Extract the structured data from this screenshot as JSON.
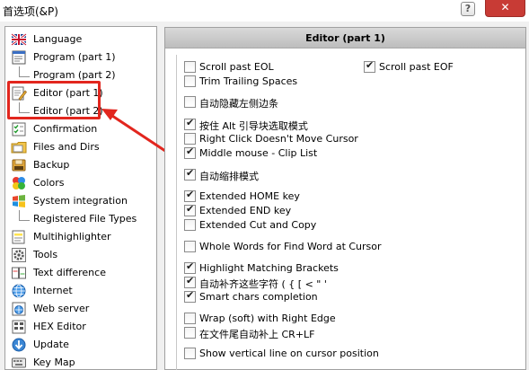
{
  "window": {
    "title": "首选项(&P)",
    "help_label": "?",
    "close_label": "✕"
  },
  "sidebar": {
    "items": [
      {
        "label": "Language",
        "icon": "uk-flag-icon",
        "child": false
      },
      {
        "label": "Program  (part 1)",
        "icon": "window-icon",
        "child": false
      },
      {
        "label": "Program  (part 2)",
        "icon": "",
        "child": true
      },
      {
        "label": "Editor  (part 1)",
        "icon": "pencil-page-icon",
        "child": false
      },
      {
        "label": "Editor  (part 2)",
        "icon": "",
        "child": true
      },
      {
        "label": "Confirmation",
        "icon": "checklist-icon",
        "child": false
      },
      {
        "label": "Files and Dirs",
        "icon": "folder-icon",
        "child": false
      },
      {
        "label": "Backup",
        "icon": "backup-icon",
        "child": false
      },
      {
        "label": "Colors",
        "icon": "palette-icon",
        "child": false
      },
      {
        "label": "System integration",
        "icon": "windows-logo-icon",
        "child": false
      },
      {
        "label": "Registered File Types",
        "icon": "",
        "child": true
      },
      {
        "label": "Multihighlighter",
        "icon": "highlight-icon",
        "child": false
      },
      {
        "label": "Tools",
        "icon": "gear-icon",
        "child": false
      },
      {
        "label": "Text difference",
        "icon": "diff-icon",
        "child": false
      },
      {
        "label": "Internet",
        "icon": "globe-icon",
        "child": false
      },
      {
        "label": "Web server",
        "icon": "web-server-icon",
        "child": false
      },
      {
        "label": "HEX Editor",
        "icon": "hex-icon",
        "child": false
      },
      {
        "label": "Update",
        "icon": "update-icon",
        "child": false
      },
      {
        "label": "Key Map",
        "icon": "keymap-icon",
        "child": false
      }
    ],
    "selected_index": 3
  },
  "panel": {
    "header": "Editor  (part 1)",
    "left_options": [
      {
        "label": "Scroll past EOL",
        "checked": false
      },
      {
        "label": "Trim Trailing Spaces",
        "checked": false
      },
      {
        "label": "自动隐藏左侧边条",
        "checked": false
      },
      {
        "label": "按住 Alt 引导块选取模式",
        "checked": true
      },
      {
        "label": "Right Click Doesn't Move Cursor",
        "checked": false
      },
      {
        "label": "Middle mouse - Clip List",
        "checked": true
      },
      {
        "label": "自动缩排模式",
        "checked": true
      },
      {
        "label": "Extended HOME key",
        "checked": true
      },
      {
        "label": "Extended END key",
        "checked": true
      },
      {
        "label": "Extended Cut and Copy",
        "checked": false
      },
      {
        "label": "Whole Words for Find Word at Cursor",
        "checked": false
      },
      {
        "label": "Highlight Matching Brackets",
        "checked": true
      },
      {
        "label": "自动补齐这些字符 ( { [ < \" '",
        "checked": true
      },
      {
        "label": "Smart chars completion",
        "checked": true
      },
      {
        "label": "Wrap (soft) with Right Edge",
        "checked": false
      },
      {
        "label": "在文件尾自动补上 CR+LF",
        "checked": false
      },
      {
        "label": "Show vertical line on cursor position",
        "checked": false
      }
    ],
    "right_options": [
      {
        "label": "Scroll past EOF",
        "checked": true
      }
    ]
  },
  "annotation": {
    "color": "#e2261e"
  }
}
